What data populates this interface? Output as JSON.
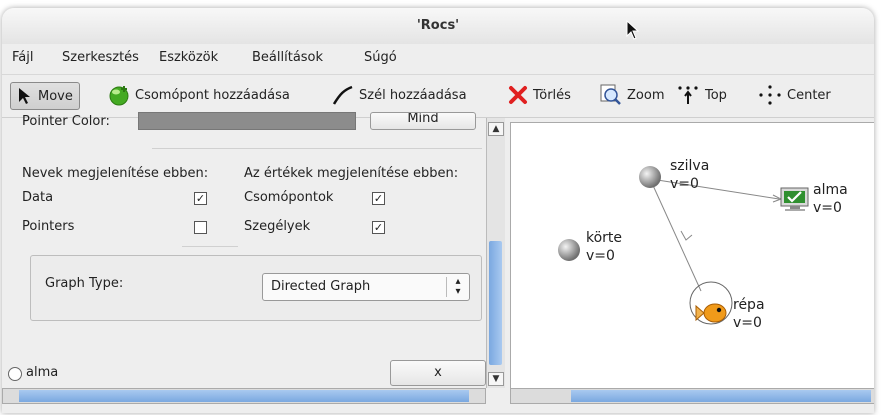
{
  "window": {
    "title": "'Rocs'"
  },
  "menu": {
    "file": "Fájl",
    "edit": "Szerkesztés",
    "tools": "Eszközök",
    "settings": "Beállítások",
    "help": "Súgó"
  },
  "toolbar": {
    "move": "Move",
    "add_node": "Csomópont hozzáadása",
    "add_edge": "Szél hozzáadása",
    "delete": "Törlés",
    "zoom": "Zoom",
    "top": "Top",
    "center": "Center"
  },
  "panel": {
    "pointer_color_label": "Pointer Color:",
    "mind_button": "Mind",
    "names_header": "Nevek megjelenítése ebben:",
    "values_header": "Az értékek megjelenítése ebben:",
    "rows": [
      {
        "name_label": "Data",
        "name_checked": true,
        "value_label": "Csomópontok",
        "value_checked": true
      },
      {
        "name_label": "Pointers",
        "name_checked": false,
        "value_label": "Szegélyek",
        "value_checked": true
      }
    ],
    "graph_type_label": "Graph Type:",
    "graph_type_value": "Directed Graph",
    "radio_label": "alma",
    "x_button": "x"
  },
  "graph": {
    "nodes": [
      {
        "name": "szilva",
        "value": "v=0",
        "icon": "grey-sphere-icon"
      },
      {
        "name": "alma",
        "value": "v=0",
        "icon": "monitor-check-icon"
      },
      {
        "name": "körte",
        "value": "v=0",
        "icon": "grey-sphere-icon"
      },
      {
        "name": "répa",
        "value": "v=0",
        "icon": "goldfish-icon"
      }
    ]
  },
  "colors": {
    "scroll_accent": "#7aa8e0",
    "delete_red": "#e02020",
    "node_green": "#44aa22"
  }
}
